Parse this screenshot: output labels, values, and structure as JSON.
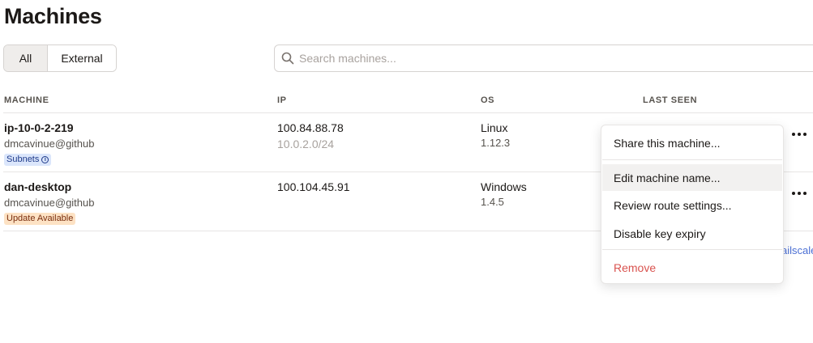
{
  "page": {
    "title": "Machines"
  },
  "filters": {
    "all_label": "All",
    "external_label": "External",
    "active": "All"
  },
  "search": {
    "placeholder": "Search machines..."
  },
  "table": {
    "columns": {
      "machine": "MACHINE",
      "ip": "IP",
      "os": "OS",
      "last_seen": "LAST SEEN"
    },
    "rows": [
      {
        "name": "ip-10-0-2-219",
        "owner": "dmcavinue@github",
        "badge": "Subnets",
        "ip": "100.84.88.78",
        "subnet": "10.0.2.0/24",
        "os": "Linux",
        "version": "1.12.3"
      },
      {
        "name": "dan-desktop",
        "owner": "dmcavinue@github",
        "badge": "Update Available",
        "ip": "100.104.45.91",
        "os": "Windows",
        "version": "1.4.5"
      }
    ],
    "peek_text": "ailscale"
  },
  "context_menu": {
    "items": [
      {
        "label": "Share this machine..."
      },
      {
        "label": "Edit machine name..."
      },
      {
        "label": "Review route settings..."
      },
      {
        "label": "Disable key expiry"
      },
      {
        "label": "Remove"
      }
    ]
  },
  "colors": {
    "danger": "#d9534f",
    "subnets_badge": "#dbe6fb",
    "update_badge": "#fde2c4"
  },
  "icons": {
    "search": "search-icon",
    "more": "more-horizontal-icon",
    "info": "info-icon"
  }
}
